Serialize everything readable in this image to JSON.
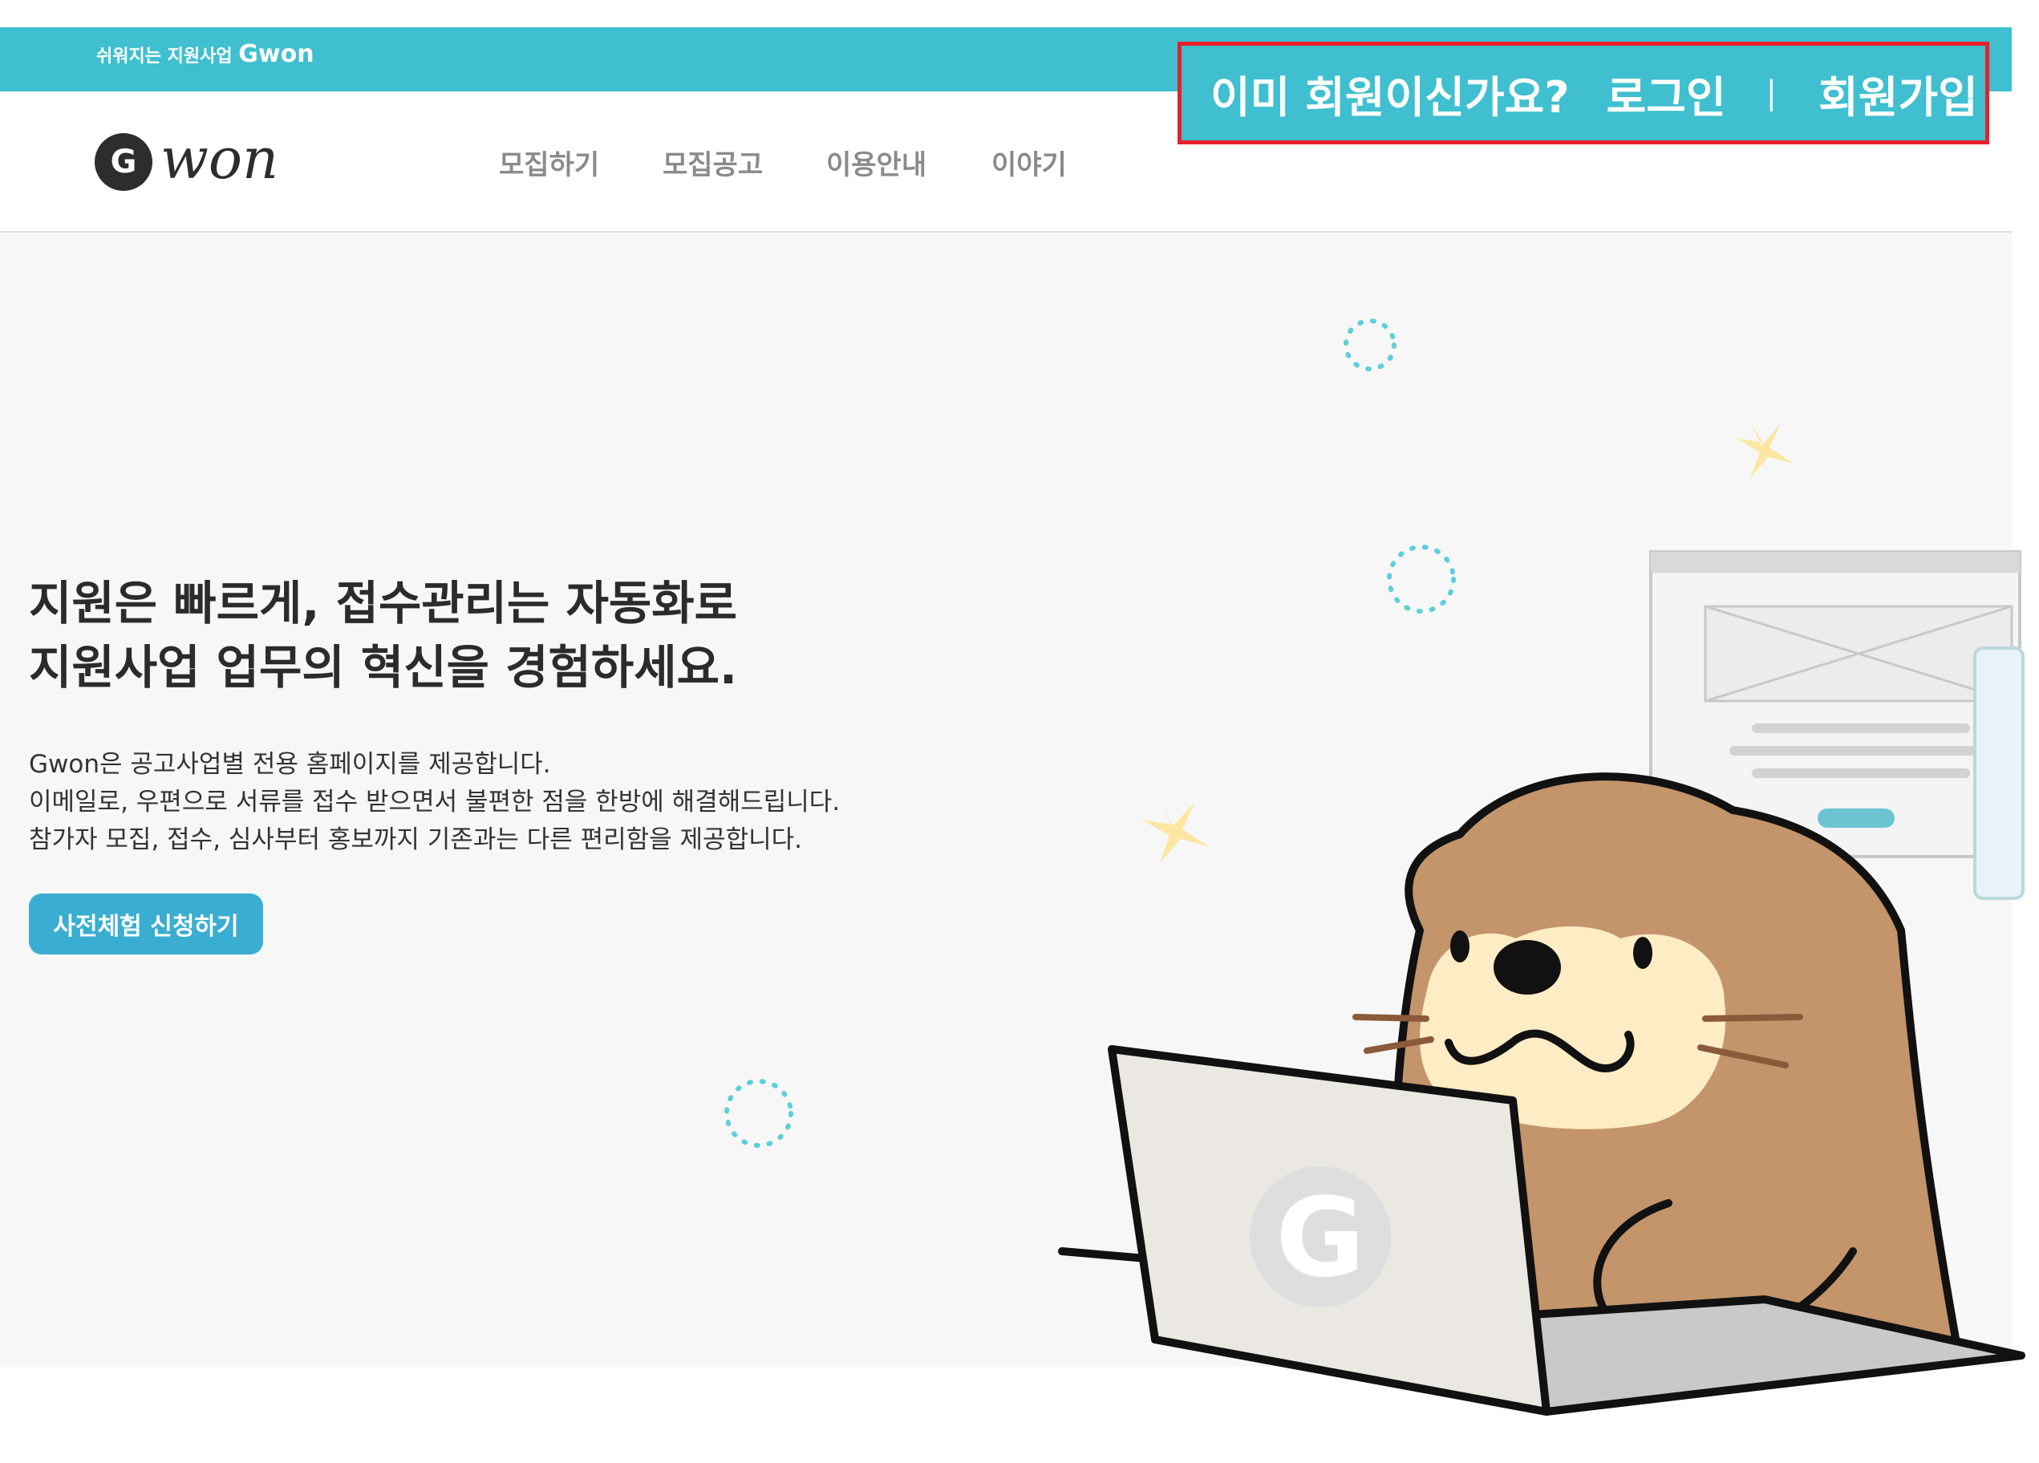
{
  "topbar": {
    "tagline": "쉬워지는 지원사업 ",
    "brand": "Gwon"
  },
  "auth": {
    "question": "이미 회원이신가요?",
    "login": "로그인",
    "separator": "|",
    "signup": "회원가입"
  },
  "logo": {
    "wordmark": "won",
    "initial": "G"
  },
  "nav": {
    "items": [
      "모집하기",
      "모집공고",
      "이용안내",
      "이야기"
    ]
  },
  "hero": {
    "headline": [
      "지원은 빠르게, 접수관리는 자동화로",
      "지원사업 업무의 혁신을 경험하세요."
    ],
    "description": [
      "Gwon은 공고사업별 전용 홈페이지를 제공합니다.",
      "이메일로, 우편으로 서류를 접수 받으면서 불편한 점을 한방에 해결해드립니다.",
      "참가자 모집, 접수, 심사부터 홍보까지 기존과는 다른 편리함을 제공합니다."
    ],
    "cta_label": "사전체험 신청하기"
  },
  "illustration": {
    "laptop_logo": "G"
  },
  "colors": {
    "teal": "#3fbfcf",
    "highlight_border": "#e8202a",
    "button": "#3aaed0",
    "otter": "#c4946a",
    "otter_face": "#fdecc4"
  }
}
